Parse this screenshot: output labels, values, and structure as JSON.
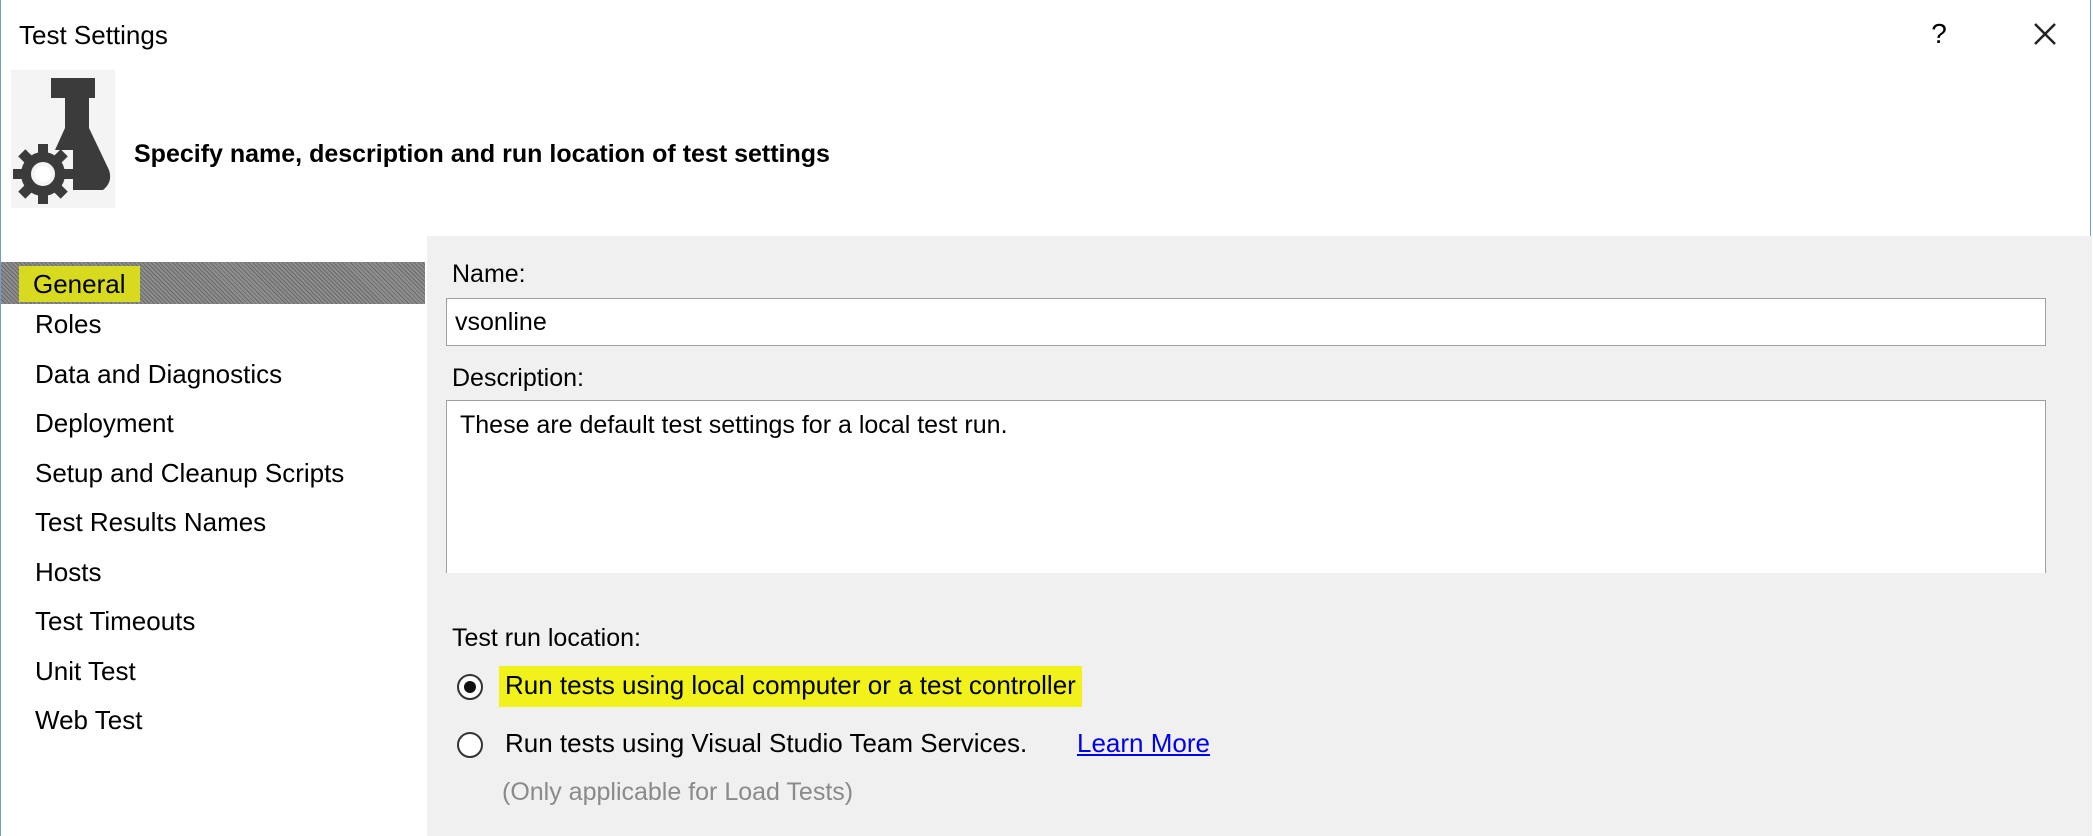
{
  "window": {
    "title": "Test Settings",
    "help_label": "?"
  },
  "banner": {
    "heading": "Specify name, description and run location of test settings",
    "icon": "flask-gear-icon"
  },
  "nav": {
    "items": [
      {
        "label": "General",
        "selected": true
      },
      {
        "label": "Roles"
      },
      {
        "label": "Data and Diagnostics"
      },
      {
        "label": "Deployment"
      },
      {
        "label": "Setup and Cleanup Scripts"
      },
      {
        "label": "Test Results Names"
      },
      {
        "label": "Hosts"
      },
      {
        "label": "Test Timeouts"
      },
      {
        "label": "Unit Test"
      },
      {
        "label": "Web Test"
      }
    ]
  },
  "form": {
    "name_label": "Name:",
    "name_value": "vsonline",
    "description_label": "Description:",
    "description_value": "These are default test settings for a local test run.",
    "location_label": "Test run location:",
    "options": [
      {
        "label": "Run tests using local computer or a test controller",
        "checked": true
      },
      {
        "label": "Run tests using Visual Studio Team Services.",
        "checked": false
      }
    ],
    "learn_more": "Learn More",
    "note": "(Only applicable for Load Tests)"
  },
  "colors": {
    "highlight": "#f0f21a",
    "panel": "#f0f0f0",
    "link": "#0000ee",
    "border": "#6e9ed0"
  }
}
